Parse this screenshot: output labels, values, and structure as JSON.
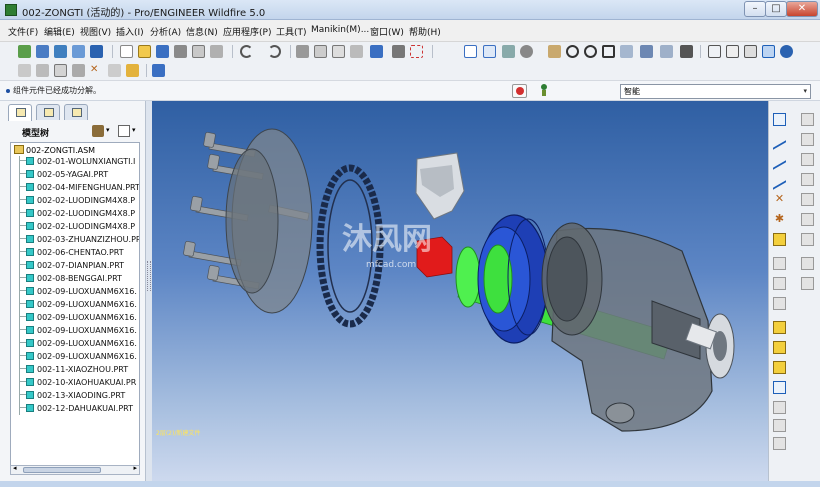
{
  "window": {
    "title": "002-ZONGTI (活动的) - Pro/ENGINEER Wildfire 5.0",
    "min_glyph": "–",
    "max_glyph": "□",
    "close_glyph": "✕"
  },
  "menu": [
    {
      "label": "文件(F)"
    },
    {
      "label": "编辑(E)"
    },
    {
      "label": "视图(V)"
    },
    {
      "label": "插入(I)"
    },
    {
      "label": "分析(A)"
    },
    {
      "label": "信息(N)"
    },
    {
      "label": "应用程序(P)"
    },
    {
      "label": "工具(T)"
    },
    {
      "label": "Manikin(M)..."
    },
    {
      "label": "窗口(W)"
    },
    {
      "label": "帮助(H)"
    }
  ],
  "message": {
    "text": "组件元件已经成功分解。"
  },
  "filter": {
    "value": "智能",
    "arrow": "▾"
  },
  "left_panel": {
    "tree_title": "模型树"
  },
  "tree": {
    "root": "002-ZONGTI.ASM",
    "items": [
      "002-01-WOLUNXIANGTI.I",
      "002-05-YAGAI.PRT",
      "002-04-MIFENGHUAN.PRT",
      "002-02-LUODINGM4X8.P",
      "002-02-LUODINGM4X8.P",
      "002-02-LUODINGM4X8.P",
      "002-03-ZHUANZIZHOU.PR",
      "002-06-CHENTAO.PRT",
      "002-07-DIANPIAN.PRT",
      "002-08-BENGGAI.PRT",
      "002-09-LUOXUANM6X16.",
      "002-09-LUOXUANM6X16.",
      "002-09-LUOXUANM6X16.",
      "002-09-LUOXUANM6X16.",
      "002-09-LUOXUANM6X16.",
      "002-09-LUOXUANM6X16.",
      "002-11-XIAOZHOU.PRT",
      "002-10-XIAOHUAKUAI.PR",
      "002-13-XIAODING.PRT",
      "002-12-DAHUAKUAI.PRT"
    ]
  },
  "viewport": {
    "watermark_text": "沐风网",
    "watermark_url": "mfcad.com",
    "note": "2层(2)/新建文件"
  },
  "colors": {
    "viewport_top": "#2f5fa3",
    "viewport_bottom": "#cdd9ee",
    "part_gray": "#6f7780",
    "part_blue": "#1e3fb5",
    "part_green": "#3ee03e",
    "part_red": "#e11b1b"
  },
  "icons": {
    "toolbar_row1": [
      "regenerate-icon",
      "open-icon",
      "save-icon",
      "print-icon",
      "cut-icon",
      "copy-icon",
      "paste-icon",
      "undo-icon",
      "redo-icon",
      "zoom-in-icon",
      "zoom-out-icon",
      "refit-icon",
      "view-manager-icon",
      "shading-icon"
    ],
    "sketch_tools": [
      "line-icon",
      "rectangle-icon",
      "arc-icon",
      "spline-icon",
      "point-icon",
      "coordinate-icon"
    ]
  }
}
